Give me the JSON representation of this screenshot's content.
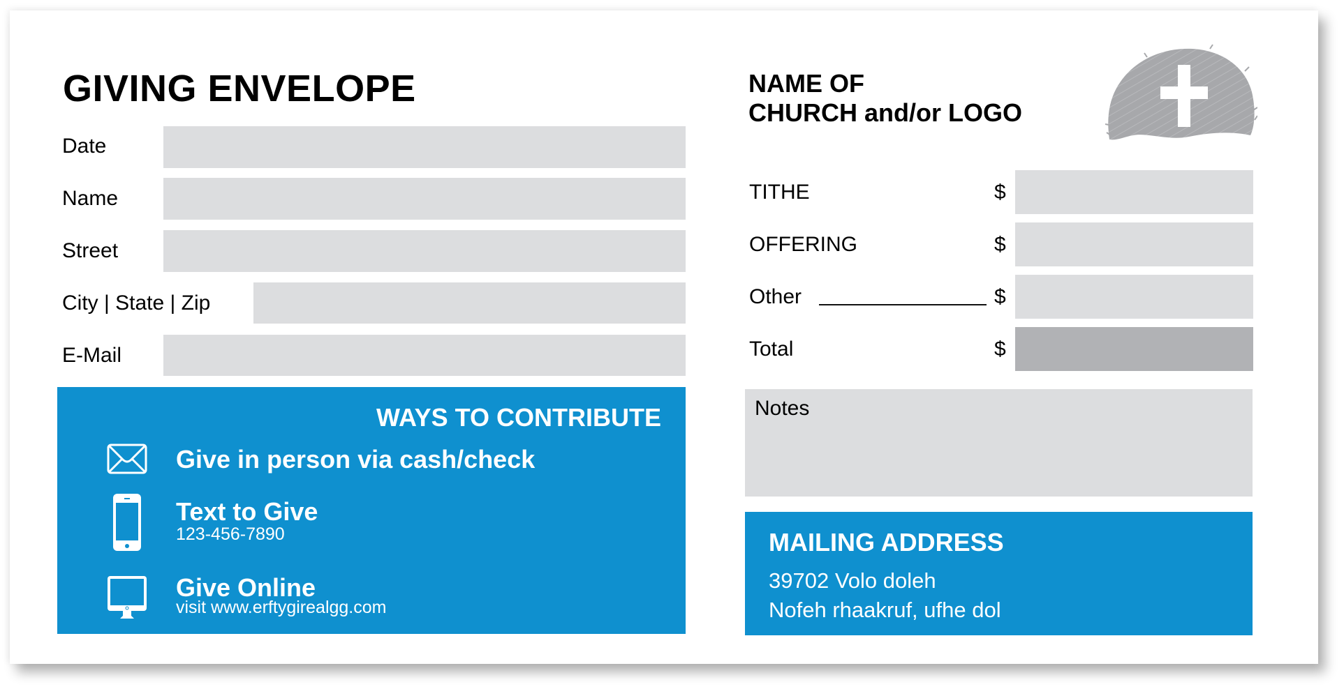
{
  "envelope": {
    "title": "GIVING ENVELOPE",
    "fields": [
      {
        "label": "Date",
        "value": ""
      },
      {
        "label": "Name",
        "value": ""
      },
      {
        "label": "Street",
        "value": ""
      },
      {
        "label": "City | State | Zip",
        "value": ""
      },
      {
        "label": "E-Mail",
        "value": ""
      }
    ]
  },
  "ways": {
    "heading": "WAYS TO CONTRIBUTE",
    "items": [
      {
        "icon": "envelope-icon",
        "title": "Give in person via cash/check",
        "subtitle": ""
      },
      {
        "icon": "phone-icon",
        "title": "Text to Give",
        "subtitle": "123-456-7890"
      },
      {
        "icon": "monitor-icon",
        "title": "Give Online",
        "subtitle": "visit www.erftygirealgg.com"
      }
    ]
  },
  "church": {
    "name_line1": "NAME OF",
    "name_line2": "CHURCH and/or LOGO",
    "logo_icon": "cross-logo-icon"
  },
  "amounts": {
    "currency_symbol": "$",
    "rows": [
      {
        "label": "TITHE",
        "value": ""
      },
      {
        "label": "OFFERING",
        "value": ""
      },
      {
        "label": "Other",
        "value": ""
      },
      {
        "label": "Total",
        "value": ""
      }
    ]
  },
  "notes": {
    "label": "Notes",
    "value": ""
  },
  "mailing": {
    "heading": "MAILING ADDRESS",
    "line1": "39702 Volo doleh",
    "line2": "Nofeh rhaakruf, ufhe dol"
  },
  "colors": {
    "accent_blue": "#0f90cf",
    "field_gray": "#dcdddf",
    "total_gray": "#b1b2b5",
    "logo_gray": "#a7a8ab"
  }
}
